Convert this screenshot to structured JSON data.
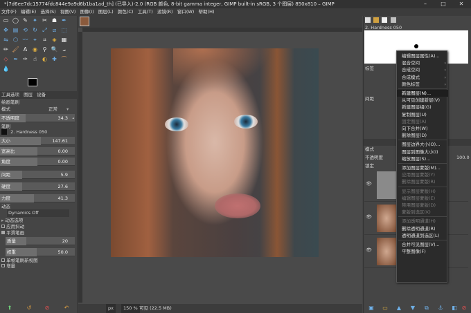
{
  "window": {
    "title": "*[7d6ee7dc15774fdc844e9a9d6b1ba1ad_th] (已导入)-2.0 (RGB 颜色, 8-bit gamma integer, GIMP built-in sRGB, 3 个图层) 850x810 – GIMP",
    "minimize": "–",
    "maximize": "□",
    "close": "✕"
  },
  "menubar": [
    "文件(F)",
    "编辑(E)",
    "选择(S)",
    "视图(V)",
    "图像(I)",
    "图层(L)",
    "颜色(C)",
    "工具(T)",
    "滤镜(R)",
    "窗口(W)",
    "帮助(H)"
  ],
  "toolbox": {
    "tabs": [
      "工具选项",
      "图层",
      "设备"
    ],
    "heading": "绘画笔刷",
    "mode_label": "模式",
    "mode_value": "正常",
    "opacity_label": "不透明度",
    "opacity_value": "34.3",
    "brush_label": "笔刷",
    "brush_name": "2. Hardness 050",
    "sliders": [
      {
        "label": "大小",
        "value": "147.61",
        "fill": 0.55
      },
      {
        "label": "宽高比",
        "value": "0.00",
        "fill": 0.5
      },
      {
        "label": "角度",
        "value": "0.00",
        "fill": 0.5
      },
      {
        "label": "间距",
        "value": "5.9",
        "fill": 0.3
      },
      {
        "label": "硬度",
        "value": "27.6",
        "fill": 0.3
      },
      {
        "label": "力度",
        "value": "41.3",
        "fill": 0.45
      }
    ],
    "dynamics_label": "动态",
    "dynamics_value": "Dynamics Off",
    "dynamics_options": "动态选项",
    "apply_jitter": "应用抖动",
    "smooth_stroke": "平滑笔画",
    "quality_label": "质量",
    "quality_value": "20",
    "weight_label": "权重",
    "weight_value": "50.0",
    "lock_brush": "单帧笔刷新视图",
    "incremental": "增量"
  },
  "canvas": {
    "zoom": "150 %",
    "unit": "px",
    "status_text": "可见 (22.5 MB)"
  },
  "rightpanel": {
    "brush_title": "2. Hardness 050",
    "filter_label": "标签",
    "spacing_label": "间距",
    "mode_label": "模式",
    "opacity_label": "不透明度",
    "opacity_value": "100.0",
    "lock_label": "锁定"
  },
  "context_menu": [
    {
      "label": "编辑图层属性(A)...",
      "state": "normal"
    },
    {
      "label": "混合空间",
      "state": "normal",
      "sub": true
    },
    {
      "label": "合成空间",
      "state": "normal",
      "sub": true
    },
    {
      "label": "合成模式",
      "state": "normal",
      "sub": true
    },
    {
      "label": "颜色标签",
      "state": "normal",
      "sub": true
    },
    {
      "sep": true
    },
    {
      "label": "新建图层(N)...",
      "state": "hl"
    },
    {
      "label": "从可见创建新层(V)",
      "state": "normal"
    },
    {
      "label": "新建图层组(G)",
      "state": "normal"
    },
    {
      "label": "复制图层(U)",
      "state": "normal"
    },
    {
      "label": "固定图层(A)",
      "state": "dis"
    },
    {
      "label": "向下合并(W)",
      "state": "normal"
    },
    {
      "label": "删除图层(D)",
      "state": "normal"
    },
    {
      "sep": true
    },
    {
      "label": "图层边界大小(O)...",
      "state": "normal"
    },
    {
      "label": "图层到图像大小(I)",
      "state": "normal"
    },
    {
      "label": "缩放图层(S)...",
      "state": "normal"
    },
    {
      "sep": true
    },
    {
      "label": "添加图层蒙版(M)...",
      "state": "normal"
    },
    {
      "label": "应用图层蒙版(Y)",
      "state": "dis"
    },
    {
      "label": "删除图层蒙版(R)",
      "state": "dis"
    },
    {
      "sep": true
    },
    {
      "label": "显示图层蒙版(H)",
      "state": "dis"
    },
    {
      "label": "编辑图层蒙版(E)",
      "state": "dis"
    },
    {
      "label": "禁用图层蒙版(D)",
      "state": "dis"
    },
    {
      "label": "蒙版到选区(K)",
      "state": "dis"
    },
    {
      "sep": true
    },
    {
      "label": "添加透明通道(H)",
      "state": "dis"
    },
    {
      "label": "删除透明通道(R)",
      "state": "normal"
    },
    {
      "label": "透明通道到选区(L)",
      "state": "normal"
    },
    {
      "sep": true
    },
    {
      "label": "合并可见图层(V)...",
      "state": "normal"
    },
    {
      "label": "平整图像(F)",
      "state": "normal"
    }
  ],
  "colors": {
    "bg": "#454545",
    "menu_bg": "#2b2b2b",
    "highlight": "#1e1e1e"
  }
}
